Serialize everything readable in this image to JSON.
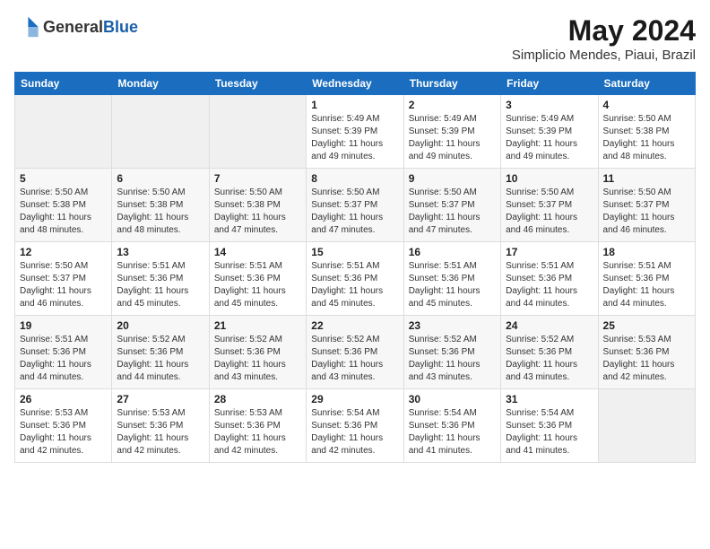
{
  "header": {
    "logo_general": "General",
    "logo_blue": "Blue",
    "title": "May 2024",
    "location": "Simplicio Mendes, Piaui, Brazil"
  },
  "days_of_week": [
    "Sunday",
    "Monday",
    "Tuesday",
    "Wednesday",
    "Thursday",
    "Friday",
    "Saturday"
  ],
  "weeks": [
    [
      {
        "day": "",
        "info": ""
      },
      {
        "day": "",
        "info": ""
      },
      {
        "day": "",
        "info": ""
      },
      {
        "day": "1",
        "info": "Sunrise: 5:49 AM\nSunset: 5:39 PM\nDaylight: 11 hours and 49 minutes."
      },
      {
        "day": "2",
        "info": "Sunrise: 5:49 AM\nSunset: 5:39 PM\nDaylight: 11 hours and 49 minutes."
      },
      {
        "day": "3",
        "info": "Sunrise: 5:49 AM\nSunset: 5:39 PM\nDaylight: 11 hours and 49 minutes."
      },
      {
        "day": "4",
        "info": "Sunrise: 5:50 AM\nSunset: 5:38 PM\nDaylight: 11 hours and 48 minutes."
      }
    ],
    [
      {
        "day": "5",
        "info": "Sunrise: 5:50 AM\nSunset: 5:38 PM\nDaylight: 11 hours and 48 minutes."
      },
      {
        "day": "6",
        "info": "Sunrise: 5:50 AM\nSunset: 5:38 PM\nDaylight: 11 hours and 48 minutes."
      },
      {
        "day": "7",
        "info": "Sunrise: 5:50 AM\nSunset: 5:38 PM\nDaylight: 11 hours and 47 minutes."
      },
      {
        "day": "8",
        "info": "Sunrise: 5:50 AM\nSunset: 5:37 PM\nDaylight: 11 hours and 47 minutes."
      },
      {
        "day": "9",
        "info": "Sunrise: 5:50 AM\nSunset: 5:37 PM\nDaylight: 11 hours and 47 minutes."
      },
      {
        "day": "10",
        "info": "Sunrise: 5:50 AM\nSunset: 5:37 PM\nDaylight: 11 hours and 46 minutes."
      },
      {
        "day": "11",
        "info": "Sunrise: 5:50 AM\nSunset: 5:37 PM\nDaylight: 11 hours and 46 minutes."
      }
    ],
    [
      {
        "day": "12",
        "info": "Sunrise: 5:50 AM\nSunset: 5:37 PM\nDaylight: 11 hours and 46 minutes."
      },
      {
        "day": "13",
        "info": "Sunrise: 5:51 AM\nSunset: 5:36 PM\nDaylight: 11 hours and 45 minutes."
      },
      {
        "day": "14",
        "info": "Sunrise: 5:51 AM\nSunset: 5:36 PM\nDaylight: 11 hours and 45 minutes."
      },
      {
        "day": "15",
        "info": "Sunrise: 5:51 AM\nSunset: 5:36 PM\nDaylight: 11 hours and 45 minutes."
      },
      {
        "day": "16",
        "info": "Sunrise: 5:51 AM\nSunset: 5:36 PM\nDaylight: 11 hours and 45 minutes."
      },
      {
        "day": "17",
        "info": "Sunrise: 5:51 AM\nSunset: 5:36 PM\nDaylight: 11 hours and 44 minutes."
      },
      {
        "day": "18",
        "info": "Sunrise: 5:51 AM\nSunset: 5:36 PM\nDaylight: 11 hours and 44 minutes."
      }
    ],
    [
      {
        "day": "19",
        "info": "Sunrise: 5:51 AM\nSunset: 5:36 PM\nDaylight: 11 hours and 44 minutes."
      },
      {
        "day": "20",
        "info": "Sunrise: 5:52 AM\nSunset: 5:36 PM\nDaylight: 11 hours and 44 minutes."
      },
      {
        "day": "21",
        "info": "Sunrise: 5:52 AM\nSunset: 5:36 PM\nDaylight: 11 hours and 43 minutes."
      },
      {
        "day": "22",
        "info": "Sunrise: 5:52 AM\nSunset: 5:36 PM\nDaylight: 11 hours and 43 minutes."
      },
      {
        "day": "23",
        "info": "Sunrise: 5:52 AM\nSunset: 5:36 PM\nDaylight: 11 hours and 43 minutes."
      },
      {
        "day": "24",
        "info": "Sunrise: 5:52 AM\nSunset: 5:36 PM\nDaylight: 11 hours and 43 minutes."
      },
      {
        "day": "25",
        "info": "Sunrise: 5:53 AM\nSunset: 5:36 PM\nDaylight: 11 hours and 42 minutes."
      }
    ],
    [
      {
        "day": "26",
        "info": "Sunrise: 5:53 AM\nSunset: 5:36 PM\nDaylight: 11 hours and 42 minutes."
      },
      {
        "day": "27",
        "info": "Sunrise: 5:53 AM\nSunset: 5:36 PM\nDaylight: 11 hours and 42 minutes."
      },
      {
        "day": "28",
        "info": "Sunrise: 5:53 AM\nSunset: 5:36 PM\nDaylight: 11 hours and 42 minutes."
      },
      {
        "day": "29",
        "info": "Sunrise: 5:54 AM\nSunset: 5:36 PM\nDaylight: 11 hours and 42 minutes."
      },
      {
        "day": "30",
        "info": "Sunrise: 5:54 AM\nSunset: 5:36 PM\nDaylight: 11 hours and 41 minutes."
      },
      {
        "day": "31",
        "info": "Sunrise: 5:54 AM\nSunset: 5:36 PM\nDaylight: 11 hours and 41 minutes."
      },
      {
        "day": "",
        "info": ""
      }
    ]
  ]
}
